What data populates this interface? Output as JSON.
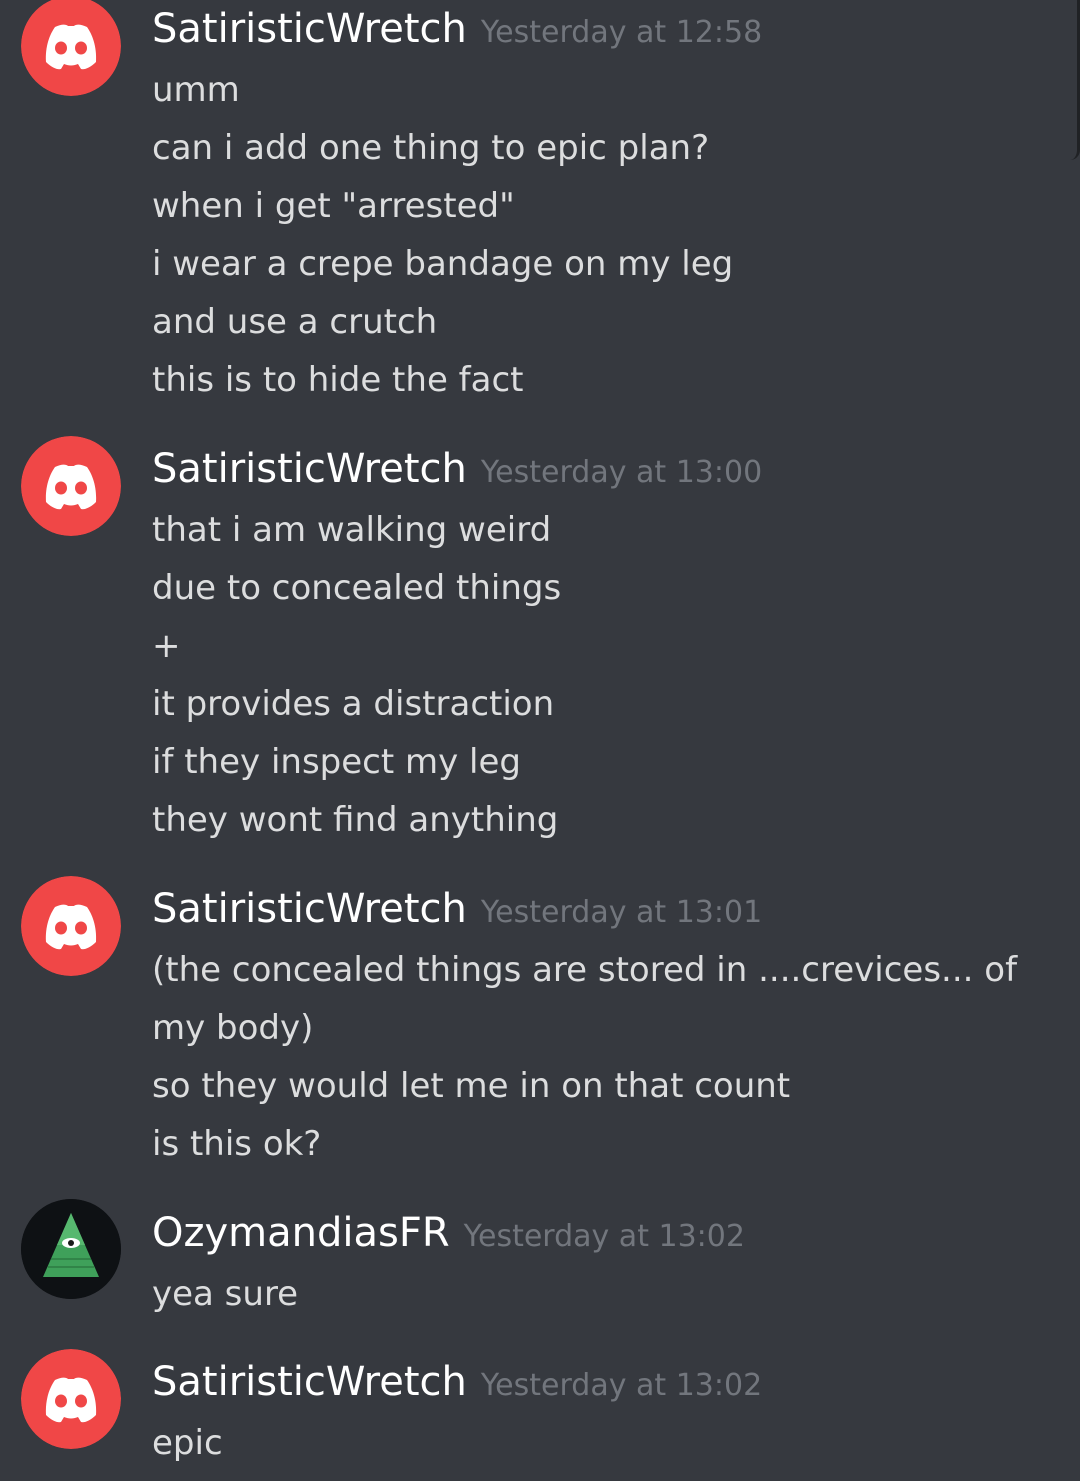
{
  "colors": {
    "background": "#36393f",
    "username": "#ffffff",
    "timestamp": "#72767d",
    "message_text": "#dcddde",
    "discord_avatar_red": "#f04747",
    "illuminati_green": "#3fa05a"
  },
  "messages": [
    {
      "author": "SatiristicWretch",
      "timestamp": "Yesterday at 12:58",
      "avatar_icon": "discord-logo-icon",
      "lines": [
        "umm",
        "can i add one thing to epic plan?",
        "when i get \"arrested\"",
        "i wear a crepe bandage on my leg",
        "and use a crutch",
        "this is to hide the fact"
      ]
    },
    {
      "author": "SatiristicWretch",
      "timestamp": "Yesterday at 13:00",
      "avatar_icon": "discord-logo-icon",
      "lines": [
        "that i am walking weird",
        "due to concealed things",
        "+",
        "it provides a distraction",
        "if they inspect my leg",
        "they wont find anything"
      ]
    },
    {
      "author": "SatiristicWretch",
      "timestamp": "Yesterday at 13:01",
      "avatar_icon": "discord-logo-icon",
      "lines": [
        "(the concealed things are stored in ....crevices... of",
        "my body)",
        "so they would let me in on that count",
        "is this ok?"
      ]
    },
    {
      "author": "OzymandiasFR",
      "timestamp": "Yesterday at 13:02",
      "avatar_icon": "illuminati-pyramid-icon",
      "lines": [
        "yea sure"
      ]
    },
    {
      "author": "SatiristicWretch",
      "timestamp": "Yesterday at 13:02",
      "avatar_icon": "discord-logo-icon",
      "lines": [
        "epic"
      ]
    }
  ]
}
